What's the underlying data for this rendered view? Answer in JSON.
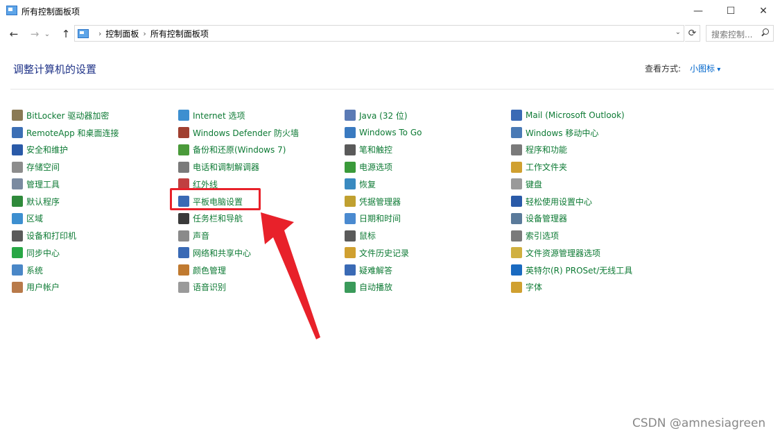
{
  "window": {
    "title": "所有控制面板项",
    "minimize": "—",
    "maximize": "☐",
    "close": "✕"
  },
  "nav": {
    "back": "←",
    "forward": "→",
    "dropdown": "⌄",
    "up": "↑",
    "refresh": "⟳"
  },
  "address": {
    "crumbs": [
      "控制面板",
      "所有控制面板项"
    ],
    "separator": "›",
    "dropdown": "⌄"
  },
  "search": {
    "placeholder": "搜索控制..."
  },
  "main": {
    "heading": "调整计算机的设置",
    "view_label": "查看方式:",
    "view_value": "小图标"
  },
  "items": {
    "col1": [
      {
        "label": "BitLocker 驱动器加密",
        "icon": "bitlocker-icon",
        "color": "#8a7a55"
      },
      {
        "label": "RemoteApp 和桌面连接",
        "icon": "remoteapp-icon",
        "color": "#3c6fb5"
      },
      {
        "label": "安全和维护",
        "icon": "flag-icon",
        "color": "#2a5aa8"
      },
      {
        "label": "存储空间",
        "icon": "storage-icon",
        "color": "#8c8c8c"
      },
      {
        "label": "管理工具",
        "icon": "admin-tools-icon",
        "color": "#7a8aa0"
      },
      {
        "label": "默认程序",
        "icon": "default-programs-icon",
        "color": "#2f8a3b"
      },
      {
        "label": "区域",
        "icon": "region-icon",
        "color": "#3d8fd0"
      },
      {
        "label": "设备和打印机",
        "icon": "printer-icon",
        "color": "#5a5a5a"
      },
      {
        "label": "同步中心",
        "icon": "sync-icon",
        "color": "#28a745"
      },
      {
        "label": "系统",
        "icon": "system-icon",
        "color": "#4a87c7"
      },
      {
        "label": "用户帐户",
        "icon": "user-accounts-icon",
        "color": "#b87a4a"
      }
    ],
    "col2": [
      {
        "label": "Internet 选项",
        "icon": "internet-icon",
        "color": "#3d8fd0"
      },
      {
        "label": "Windows Defender 防火墙",
        "icon": "firewall-icon",
        "color": "#a04030"
      },
      {
        "label": "备份和还原(Windows 7)",
        "icon": "backup-icon",
        "color": "#4a9a3a"
      },
      {
        "label": "电话和调制解调器",
        "icon": "phone-icon",
        "color": "#7a7a7a"
      },
      {
        "label": "红外线",
        "icon": "infrared-icon",
        "color": "#c04040"
      },
      {
        "label": "平板电脑设置",
        "icon": "tablet-icon",
        "color": "#3a6ab5"
      },
      {
        "label": "任务栏和导航",
        "icon": "taskbar-icon",
        "color": "#3a3a3a"
      },
      {
        "label": "声音",
        "icon": "sound-icon",
        "color": "#8a8a8a"
      },
      {
        "label": "网络和共享中心",
        "icon": "network-icon",
        "color": "#3a6ab5"
      },
      {
        "label": "颜色管理",
        "icon": "color-management-icon",
        "color": "#c07a30"
      },
      {
        "label": "语音识别",
        "icon": "microphone-icon",
        "color": "#9a9a9a"
      }
    ],
    "col3": [
      {
        "label": "Java (32 位)",
        "icon": "java-icon",
        "color": "#5a7ab5"
      },
      {
        "label": "Windows To Go",
        "icon": "windows-to-go-icon",
        "color": "#3a7ac0"
      },
      {
        "label": "笔和触控",
        "icon": "pen-icon",
        "color": "#5a5a5a"
      },
      {
        "label": "电源选项",
        "icon": "power-icon",
        "color": "#3a9a3a"
      },
      {
        "label": "恢复",
        "icon": "recovery-icon",
        "color": "#3a8ac0"
      },
      {
        "label": "凭据管理器",
        "icon": "credential-icon",
        "color": "#c0a030"
      },
      {
        "label": "日期和时间",
        "icon": "clock-icon",
        "color": "#4a8ad0"
      },
      {
        "label": "鼠标",
        "icon": "mouse-icon",
        "color": "#5a5a5a"
      },
      {
        "label": "文件历史记录",
        "icon": "file-history-icon",
        "color": "#d0a030"
      },
      {
        "label": "疑难解答",
        "icon": "troubleshoot-icon",
        "color": "#3a6ab5"
      },
      {
        "label": "自动播放",
        "icon": "autoplay-icon",
        "color": "#3a9a5a"
      }
    ],
    "col4": [
      {
        "label": "Mail (Microsoft Outlook)",
        "icon": "mail-icon",
        "color": "#3a6ab5"
      },
      {
        "label": "Windows 移动中心",
        "icon": "mobility-icon",
        "color": "#4a7ab5"
      },
      {
        "label": "程序和功能",
        "icon": "programs-icon",
        "color": "#7a7a7a"
      },
      {
        "label": "工作文件夹",
        "icon": "work-folders-icon",
        "color": "#d0a030"
      },
      {
        "label": "键盘",
        "icon": "keyboard-icon",
        "color": "#9a9a9a"
      },
      {
        "label": "轻松使用设置中心",
        "icon": "ease-of-access-icon",
        "color": "#2a5aa8"
      },
      {
        "label": "设备管理器",
        "icon": "device-manager-icon",
        "color": "#5a7a9a"
      },
      {
        "label": "索引选项",
        "icon": "indexing-icon",
        "color": "#7a7a7a"
      },
      {
        "label": "文件资源管理器选项",
        "icon": "folder-options-icon",
        "color": "#d0b040"
      },
      {
        "label": "英特尔(R) PROSet/无线工具",
        "icon": "wireless-icon",
        "color": "#1a6ac0"
      },
      {
        "label": "字体",
        "icon": "fonts-icon",
        "color": "#d0a030"
      }
    ]
  },
  "annotation": {
    "color": "#e8212a"
  },
  "watermark": "CSDN @amnesiagreen"
}
